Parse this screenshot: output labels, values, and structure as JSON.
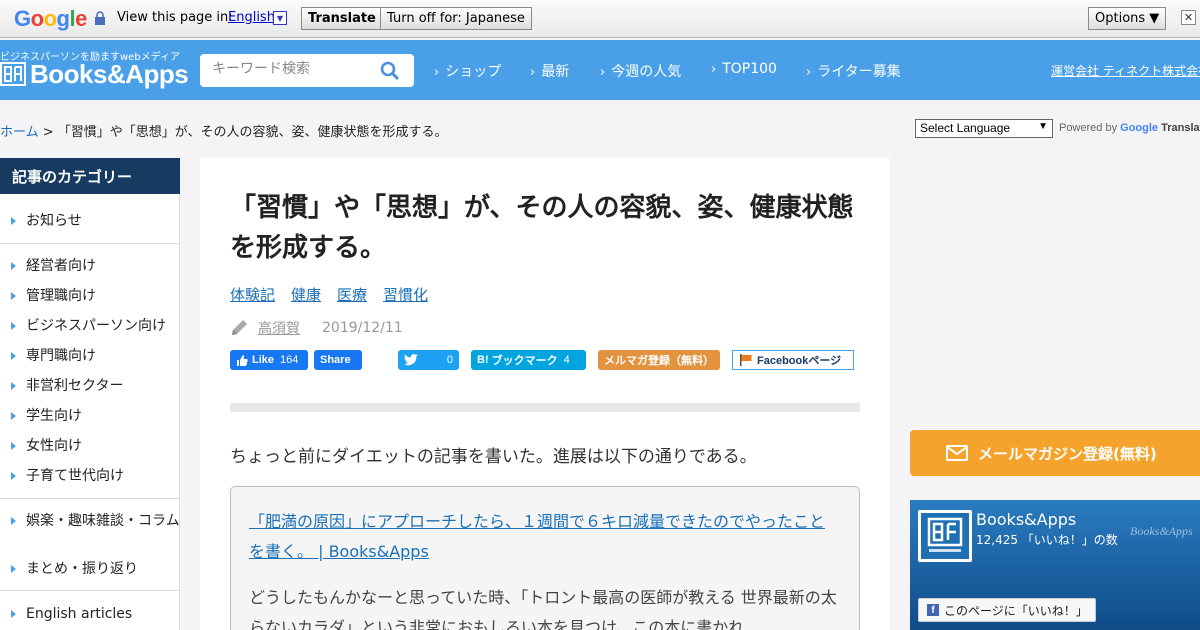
{
  "google_bar": {
    "logo_letters": [
      {
        "ch": "G",
        "color": "#4285f4"
      },
      {
        "ch": "o",
        "color": "#ea4335"
      },
      {
        "ch": "o",
        "color": "#fbbc05"
      },
      {
        "ch": "g",
        "color": "#4285f4"
      },
      {
        "ch": "l",
        "color": "#34a853"
      },
      {
        "ch": "e",
        "color": "#ea4335"
      }
    ],
    "view_label": "View this page in:",
    "language": "English",
    "translate_label": "Translate",
    "turn_off_label": "Turn off for: Japanese",
    "options_label": "Options ▼",
    "close_label": "✕"
  },
  "header": {
    "tagline": "ビジネスパーソンを励ますwebメディア",
    "logo": "Books&Apps",
    "search_placeholder": "キーワード検索",
    "nav": [
      "ショップ",
      "最新",
      "今週の人気",
      "TOP100",
      "ライター募集"
    ],
    "corp_link": "運営会社 ティネクト株式会社",
    "brand_color": "#4aa0e8"
  },
  "breadcrumb": {
    "home": "ホーム",
    "sep": " > ",
    "current": "「習慣」や「思想」が、その人の容貌、姿、健康状態を形成する。"
  },
  "translate_widget": {
    "select_label": "Select Language",
    "powered_by": "Powered by",
    "google": "Google",
    "translate": "Translate"
  },
  "sidebar": {
    "title": "記事のカテゴリー",
    "groups": [
      [
        "お知らせ"
      ],
      [
        "経営者向け",
        "管理職向け",
        "ビジネスパーソン向け",
        "専門職向け",
        "非営利セクター",
        "学生向け",
        "女性向け",
        "子育て世代向け"
      ],
      [
        "娯楽・趣味雑談・コラム",
        "まとめ・振り返り"
      ],
      [
        "English articles"
      ]
    ]
  },
  "article": {
    "title": "「習慣」や「思想」が、その人の容貌、姿、健康状態を形成する。",
    "tags": [
      "体験記",
      "健康",
      "医療",
      "習慣化"
    ],
    "author": "高須賀",
    "date": "2019/12/11",
    "share": {
      "like_label": "Like",
      "like_count": "164",
      "share_label": "Share",
      "tweet_count": "0",
      "hatena_label": "ブックマーク",
      "hatena_count": "4",
      "mailmag_label": "メルマガ登録（無料）",
      "fbpage_label": "Facebookページ"
    },
    "intro": "ちょっと前にダイエットの記事を書いた。進展は以下の通りである。",
    "quote_link": "「肥満の原因」にアプローチしたら、１週間で６キロ減量できたのでやったことを書く。 | Books&Apps",
    "quote_text": "どうしたもんかなーと思っていた時、「トロント最高の医師が教える 世界最新の太らないカラダ」という非常におもしろい本を見つけ、この本に書かれ"
  },
  "right": {
    "mail_button": "メールマガジン登録(無料)",
    "fb_name": "Books&Apps",
    "fb_count": "12,425 「いいね！」の数",
    "fb_mark": "Books&Apps",
    "fb_like_label": "このページに「いいね！」"
  }
}
